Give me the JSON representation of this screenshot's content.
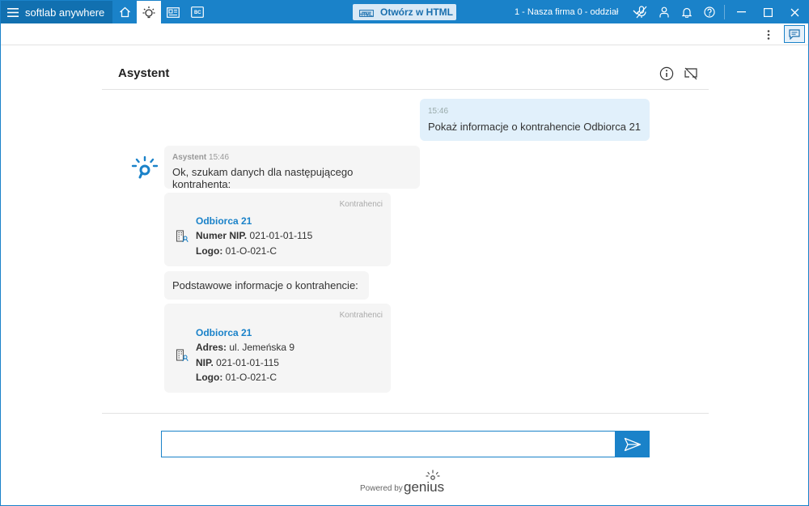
{
  "app": {
    "brand_name": "softlab anywhere",
    "html_button_label": "Otwórz w HTML",
    "html_badge_text": "HTML",
    "bc_badge_text": "BC",
    "company_selector": "1 - Nasza firma 0 - oddział"
  },
  "assistant": {
    "title": "Asystent",
    "user_message": {
      "time": "15:46",
      "text": "Pokaż informacje o kontrahencie Odbiorca 21"
    },
    "bot_message": {
      "sender": "Asystent",
      "time": "15:46",
      "text": "Ok, szukam danych dla następującego kontrahenta:"
    },
    "card1": {
      "source": "Kontrahenci",
      "name": "Odbiorca 21",
      "rows": [
        {
          "label": "Numer NIP.",
          "value": " 021-01-01-115"
        },
        {
          "label": "Logo:",
          "value": " 01-O-021-C"
        }
      ]
    },
    "bot_message2": {
      "text": "Podstawowe informacje o kontrahencie:"
    },
    "card2": {
      "source": "Kontrahenci",
      "name": "Odbiorca 21",
      "rows": [
        {
          "label": "Adres:",
          "value": " ul. Jemeńska 9"
        },
        {
          "label": "NIP.",
          "value": " 021-01-01-115"
        },
        {
          "label": "Logo:",
          "value": " 01-O-021-C"
        }
      ]
    },
    "input": {
      "value": "",
      "placeholder": ""
    },
    "footer": {
      "powered_by": "Powered by",
      "logo_text": "genius"
    }
  },
  "colors": {
    "accent": "#1a82c9",
    "user_bubble": "#e1f0fb",
    "bot_bubble": "#f5f5f5"
  }
}
